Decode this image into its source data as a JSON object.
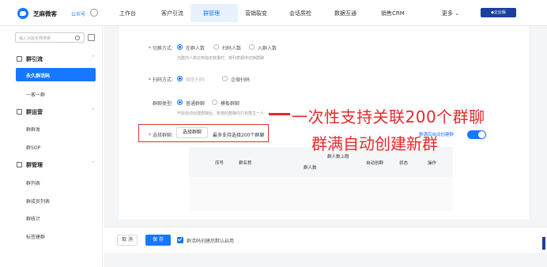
{
  "topbar": {
    "brand": "芝麻微客",
    "channel": "公众号",
    "nav": [
      "工作台",
      "客户引流",
      "群管理",
      "营销裂变",
      "会话质检",
      "数据互通",
      "销售CRM",
      "更多 ⌄"
    ],
    "active_nav": "群管理",
    "enterprise_badge": "◆企业版"
  },
  "sidebar": {
    "search_placeholder": "输入功能名称搜索",
    "groups": [
      {
        "label": "群引流",
        "items": [
          "永久群活码",
          "一客一群"
        ]
      },
      {
        "label": "群运营",
        "items": [
          "群群发",
          "群SOP"
        ]
      },
      {
        "label": "群管理",
        "items": [
          "群列表",
          "群成员列表",
          "群统计",
          "标签建群"
        ]
      }
    ],
    "active_item": "永久群活码"
  },
  "form": {
    "switch_label": "切换方式:",
    "switch_options": [
      "在群人数",
      "扫码人数",
      "入群人数"
    ],
    "switch_hint": "当群内人数达到指定数量时，按列表顺序切换群聊",
    "scan_label": "扫码方式:",
    "scan_options": [
      "微信扫码",
      "企微扫码"
    ],
    "type_label": "群聊类型:",
    "type_options": [
      "普通群聊",
      "模板群聊"
    ],
    "type_hint": "开启自动创建群聊后，新建的群聊内只有群主一人",
    "select_label": "选择群聊:",
    "select_button": "选择群聊",
    "select_hint": "最多支持选择200个群聊",
    "toggle_label": "群满后自动创建群",
    "table_headers": [
      "序号",
      "群名称",
      "群人数",
      "群人数上限",
      "自动创群",
      "状态",
      "操作"
    ]
  },
  "footer": {
    "cancel": "取 消",
    "save": "保 存",
    "checkbox_label": "群活码创建后默认启用"
  },
  "annotation": {
    "line1": "一次性支持关联200个群聊",
    "line2": "群满自动创建新群"
  }
}
